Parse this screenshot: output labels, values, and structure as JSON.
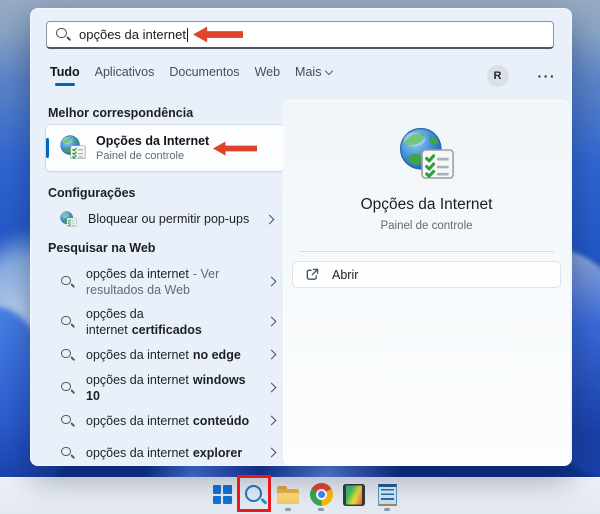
{
  "search": {
    "value": "opções da internet"
  },
  "tabs": [
    {
      "label": "Tudo",
      "active": true
    },
    {
      "label": "Aplicativos"
    },
    {
      "label": "Documentos"
    },
    {
      "label": "Web"
    },
    {
      "label": "Mais",
      "has_dropdown": true
    }
  ],
  "header": {
    "avatar_letter": "R",
    "overflow_glyph": "···"
  },
  "best_match": {
    "heading": "Melhor correspondência",
    "item": {
      "title": "Opções da Internet",
      "subtitle": "Painel de controle",
      "icon": "internet-options-icon"
    }
  },
  "settings": {
    "heading": "Configurações",
    "items": [
      {
        "label": "Bloquear ou permitir pop-ups",
        "icon": "internet-options-icon"
      }
    ]
  },
  "web_search": {
    "heading": "Pesquisar na Web",
    "items": [
      {
        "query": "opções da internet",
        "suffix": "- Ver resultados da Web"
      },
      {
        "query": "opções da internet",
        "keyword": "certificados"
      },
      {
        "query": "opções da internet",
        "keyword": "no edge"
      },
      {
        "query": "opções da internet",
        "keyword": "windows 10"
      },
      {
        "query": "opções da internet",
        "keyword": "conteúdo"
      },
      {
        "query": "opções da internet",
        "keyword": "explorer"
      }
    ]
  },
  "preview": {
    "title": "Opções da Internet",
    "subtitle": "Painel de controle",
    "actions": [
      {
        "label": "Abrir",
        "icon": "open-external-icon"
      }
    ]
  },
  "taskbar": {
    "icons": [
      {
        "name": "start"
      },
      {
        "name": "search",
        "annotated": true
      },
      {
        "name": "file-explorer",
        "running": true
      },
      {
        "name": "chrome",
        "running": true
      },
      {
        "name": "photos"
      },
      {
        "name": "notepad",
        "running": true
      }
    ]
  },
  "annotations": {
    "arrow_color": "#e0432c",
    "highlight_box_color": "#e6191f"
  },
  "colors": {
    "accent": "#0067c0",
    "panel_bg": "#e9f0f9",
    "taskbar_bg": "#e8edf4"
  }
}
